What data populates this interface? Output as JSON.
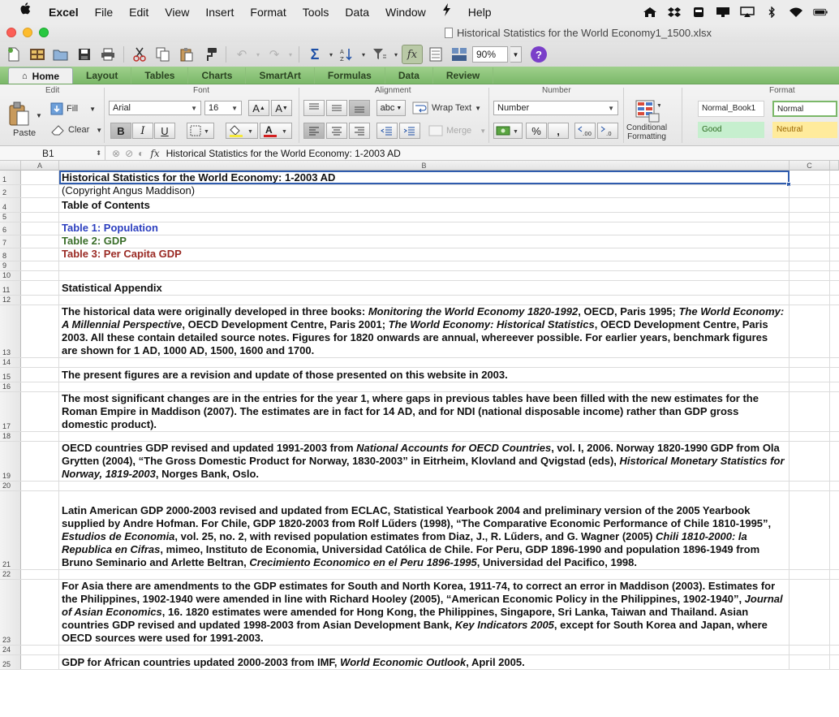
{
  "menubar": {
    "apple": "",
    "app": "Excel",
    "items": [
      "File",
      "Edit",
      "View",
      "Insert",
      "Format",
      "Tools",
      "Data",
      "Window",
      "Help"
    ]
  },
  "window": {
    "title": "Historical Statistics for the World Economy1_1500.xlsx"
  },
  "toolbar": {
    "zoom": "90%"
  },
  "ribbon": {
    "tabs": [
      "Home",
      "Layout",
      "Tables",
      "Charts",
      "SmartArt",
      "Formulas",
      "Data",
      "Review"
    ],
    "groups": {
      "edit": "Edit",
      "font": "Font",
      "alignment": "Alignment",
      "number": "Number",
      "format": "Format"
    },
    "paste": "Paste",
    "fill": "Fill",
    "clear": "Clear",
    "font_name": "Arial",
    "font_size": "16",
    "bold": "B",
    "italic": "I",
    "underline": "U",
    "wrap": "abc",
    "wrap_text": "Wrap Text",
    "merge": "Merge",
    "number_format": "Number",
    "percent": "%",
    "comma": ",",
    "conditional": "Conditional",
    "formatting": "Formatting",
    "style_normal_book": "Normal_Book1",
    "style_normal": "Normal",
    "style_good": "Good",
    "style_neutral": "Neutral"
  },
  "formula_bar": {
    "cell_ref": "B1",
    "fx": "fx",
    "content": "Historical Statistics for the World Economy:  1-2003 AD"
  },
  "columns": [
    "A",
    "B",
    "C"
  ],
  "rows": [
    {
      "n": "1",
      "text": "Historical Statistics for the World Economy:  1-2003 AD"
    },
    {
      "n": "2",
      "text": "(Copyright Angus Maddison)"
    },
    {
      "n": "4",
      "text": "Table of Contents"
    },
    {
      "n": "5",
      "text": ""
    },
    {
      "n": "6",
      "text": "Table 1: Population"
    },
    {
      "n": "7",
      "text": "Table 2: GDP"
    },
    {
      "n": "8",
      "text": "Table 3: Per Capita GDP"
    },
    {
      "n": "9",
      "text": ""
    },
    {
      "n": "10",
      "text": ""
    },
    {
      "n": "11",
      "text": "Statistical Appendix"
    },
    {
      "n": "12",
      "text": ""
    },
    {
      "n": "13",
      "parts": [
        {
          "t": "The historical data were originally developed in three books: "
        },
        {
          "t": "Monitoring the World Economy 1820-1992",
          "i": true
        },
        {
          "t": ", OECD, Paris 1995; "
        },
        {
          "t": "The World Economy: A Millennial Perspective",
          "i": true
        },
        {
          "t": ", OECD Development Centre, Paris 2001; "
        },
        {
          "t": "The World Economy: Historical Statistics",
          "i": true
        },
        {
          "t": ", OECD Development Centre, Paris 2003. All these contain detailed source notes. Figures for 1820 onwards are annual, whereever possible. For earlier years, benchmark figures are shown for 1 AD, 1000 AD, 1500, 1600 and 1700."
        }
      ]
    },
    {
      "n": "14",
      "text": ""
    },
    {
      "n": "15",
      "text": "The present figures are a revision and update of those presented on this website in 2003."
    },
    {
      "n": "16",
      "text": ""
    },
    {
      "n": "17",
      "text": "The most significant changes are in the entries for the year 1, where gaps in previous tables have been filled with the new estimates for the Roman Empire in Maddison (2007). The estimates are in fact for 14 AD, and for NDI (national disposable income) rather than GDP gross domestic product)."
    },
    {
      "n": "18",
      "text": ""
    },
    {
      "n": "19",
      "parts": [
        {
          "t": "OECD countries GDP revised and updated 1991-2003  from "
        },
        {
          "t": "National Accounts for OECD Countries",
          "i": true
        },
        {
          "t": ", vol. I, 2006. Norway 1820-1990 GDP from Ola Grytten (2004), “The Gross Domestic Product for Norway, 1830-2003” in Eitrheim, Klovland and Qvigstad (eds), "
        },
        {
          "t": "Historical Monetary Statistics for Norway, 1819-2003",
          "i": true
        },
        {
          "t": ", Norges Bank, Oslo."
        }
      ]
    },
    {
      "n": "20",
      "text": ""
    },
    {
      "n": "21",
      "parts": [
        {
          "t": "Latin American GDP 2000-2003 revised and updated from ECLAC, Statistical Yearbook 2004 and preliminary version of the 2005 Yearbook supplied by Andre Hofman. For Chile, GDP 1820-2003 from Rolf Lűders (1998), “The Comparative Economic Performance of Chile 1810-1995”, "
        },
        {
          "t": "Estudios de Economia",
          "i": true
        },
        {
          "t": ", vol. 25, no. 2, with revised population estimates from Diaz, J., R. Lűders, and G. Wagner (2005) "
        },
        {
          "t": "Chili 1810-2000: la Republica en Cifras",
          "i": true
        },
        {
          "t": ", mimeo, Instituto de Economia, Universidad Católica de Chile. For Peru, GDP 1896-1990 and population 1896-1949 from Bruno Seminario and Arlette Beltran, "
        },
        {
          "t": "Crecimiento Economico en el Peru 1896-1995",
          "i": true
        },
        {
          "t": ", Universidad del Pacifico, 1998."
        }
      ]
    },
    {
      "n": "22",
      "text": ""
    },
    {
      "n": "23",
      "parts": [
        {
          "t": "For Asia there are amendments to the GDP estimates for South and North Korea, 1911-74, to correct an error in Maddison (2003). Estimates for the Philippines, 1902-1940 were amended in line with Richard Hooley (2005), “American Economic Policy in the Philippines, 1902-1940”, "
        },
        {
          "t": "Journal of Asian Economics",
          "i": true
        },
        {
          "t": ", 16. 1820 estimates were amended for Hong Kong, the Philippines, Singapore, Sri Lanka, Taiwan and Thailand. Asian countries GDP revised and updated 1998-2003 from Asian Development Bank, "
        },
        {
          "t": "Key Indicators 2005",
          "i": true
        },
        {
          "t": ", except for South Korea and Japan, where OECD sources were used for 1991-2003."
        }
      ]
    },
    {
      "n": "24",
      "text": ""
    },
    {
      "n": "25",
      "parts": [
        {
          "t": "GDP for African countries updated 2000-2003 from IMF, "
        },
        {
          "t": "World Economic Outlook",
          "i": true
        },
        {
          "t": ", April 2005."
        }
      ]
    }
  ],
  "colors": {
    "ribbon_accent": "#7bb869",
    "toc_population": "#2c3fbf",
    "toc_gdp": "#3a6e2a",
    "toc_per_capita": "#9a2a24",
    "selection": "#2f5cae"
  }
}
